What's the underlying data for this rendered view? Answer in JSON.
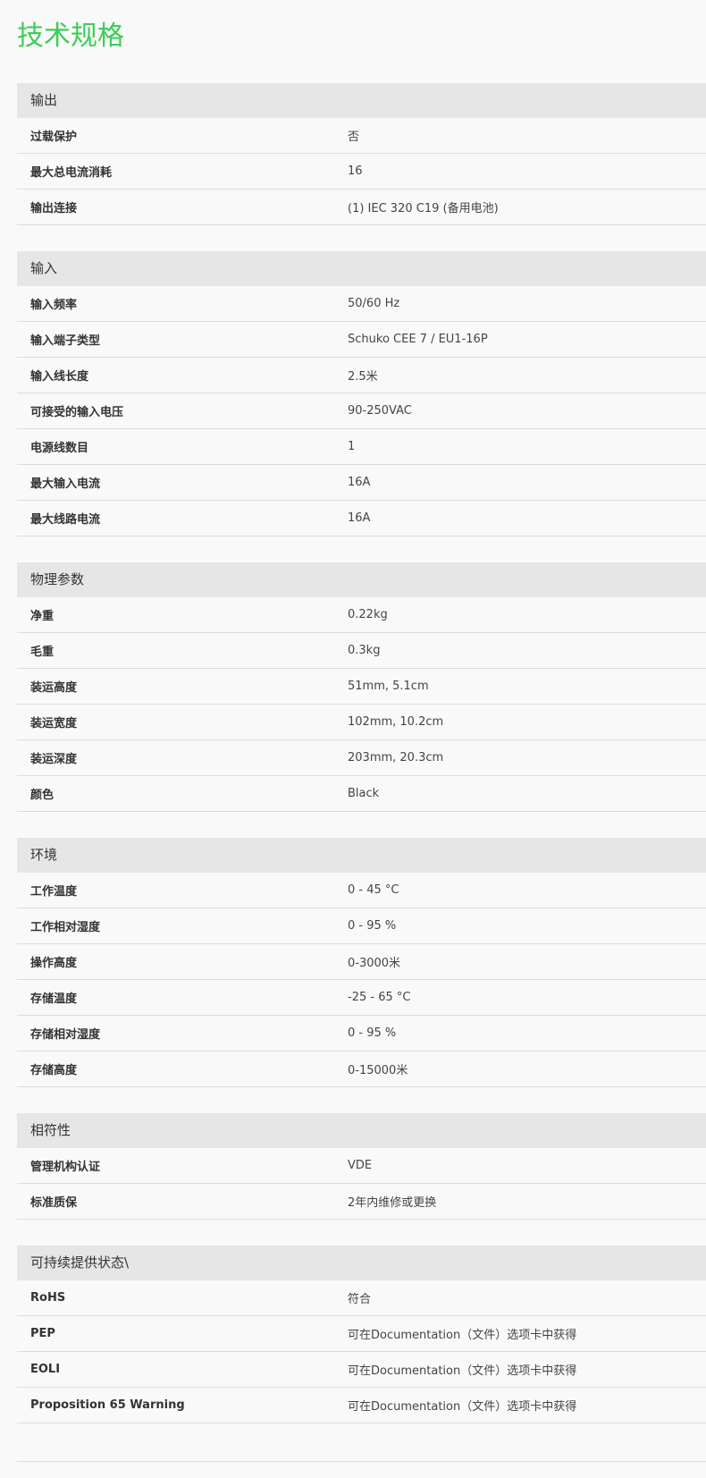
{
  "title": "技术规格",
  "accent_color": "#3dcd58",
  "sections": [
    {
      "title": "输出",
      "rows": [
        {
          "label": "过载保护",
          "value": "否"
        },
        {
          "label": "最大总电流消耗",
          "value": "16"
        },
        {
          "label": "输出连接",
          "value": "(1) IEC 320 C19 (备用电池)"
        }
      ]
    },
    {
      "title": "输入",
      "rows": [
        {
          "label": "输入频率",
          "value": "50/60 Hz"
        },
        {
          "label": "输入端子类型",
          "value": "Schuko CEE 7 / EU1-16P"
        },
        {
          "label": "输入线长度",
          "value": "2.5米"
        },
        {
          "label": "可接受的输入电压",
          "value": "90-250VAC"
        },
        {
          "label": "电源线数目",
          "value": "1"
        },
        {
          "label": "最大输入电流",
          "value": "16A"
        },
        {
          "label": "最大线路电流",
          "value": "16A"
        }
      ]
    },
    {
      "title": "物理参数",
      "rows": [
        {
          "label": "净重",
          "value": "0.22kg"
        },
        {
          "label": "毛重",
          "value": "0.3kg"
        },
        {
          "label": "装运高度",
          "value": "51mm, 5.1cm"
        },
        {
          "label": "装运宽度",
          "value": "102mm, 10.2cm"
        },
        {
          "label": "装运深度",
          "value": "203mm, 20.3cm"
        },
        {
          "label": "颜色",
          "value": "Black"
        }
      ]
    },
    {
      "title": "环境",
      "rows": [
        {
          "label": "工作温度",
          "value": "0 - 45 °C"
        },
        {
          "label": "工作相对湿度",
          "value": "0 - 95 %"
        },
        {
          "label": "操作高度",
          "value": "0-3000米"
        },
        {
          "label": "存储温度",
          "value": "-25 - 65 °C"
        },
        {
          "label": "存储相对湿度",
          "value": "0 - 95 %"
        },
        {
          "label": "存储高度",
          "value": "0-15000米"
        }
      ]
    },
    {
      "title": "相符性",
      "rows": [
        {
          "label": "管理机构认证",
          "value": "VDE"
        },
        {
          "label": "标准质保",
          "value": "2年内维修或更换"
        }
      ]
    },
    {
      "title": "可持续提供状态\\",
      "rows": [
        {
          "label": "RoHS",
          "value": "符合"
        },
        {
          "label": "PEP",
          "value": "可在Documentation（文件）选项卡中获得"
        },
        {
          "label": "EOLI",
          "value": "可在Documentation（文件）选项卡中获得"
        },
        {
          "label": "Proposition 65 Warning",
          "value": "可在Documentation（文件）选项卡中获得"
        }
      ]
    }
  ]
}
